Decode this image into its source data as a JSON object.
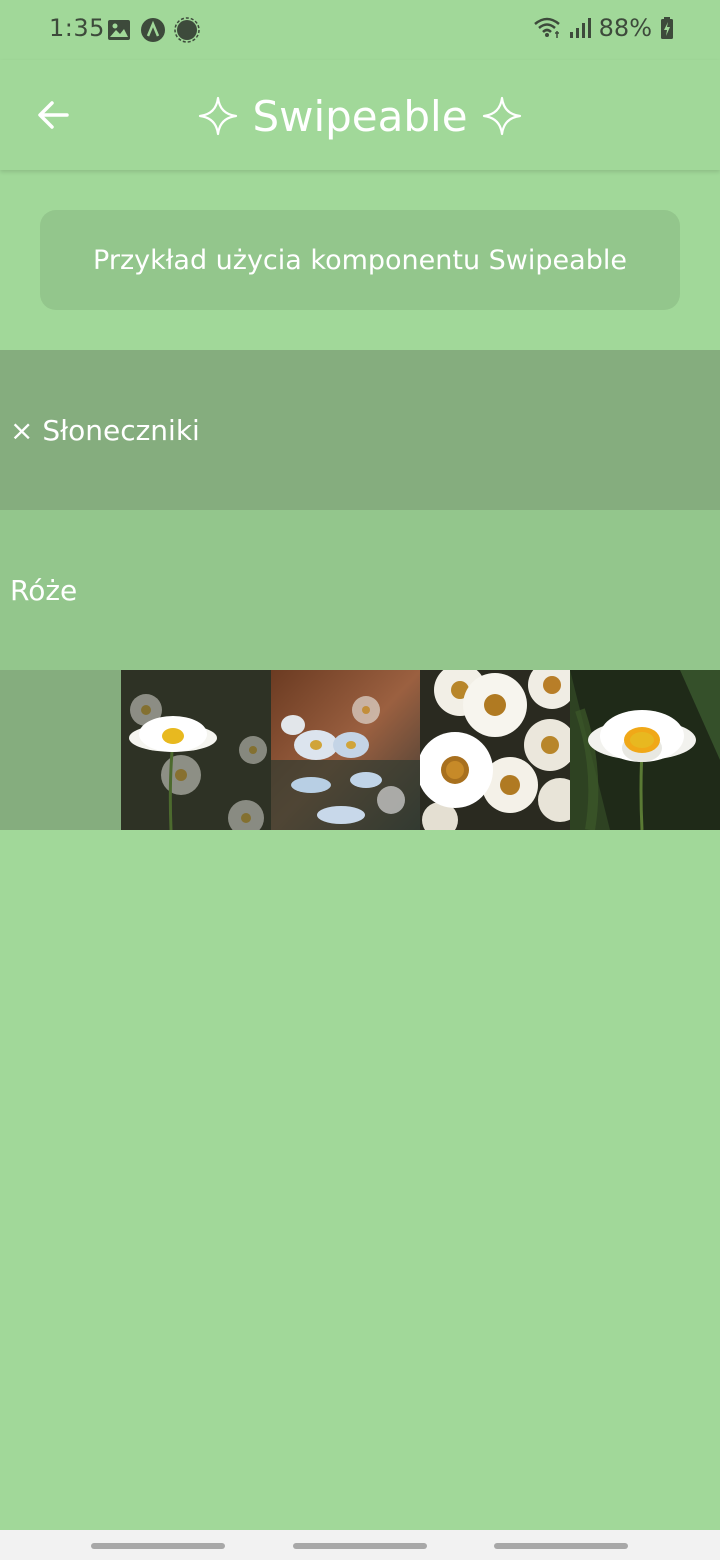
{
  "status_bar": {
    "time": "1:35",
    "battery": "88%",
    "left_icons": [
      "image-icon",
      "app-a-icon",
      "signal-messenger-icon"
    ],
    "right_icons": [
      "wifi-icon",
      "cell-signal-icon",
      "battery-charging-icon"
    ]
  },
  "app_bar": {
    "title": "Swipeable",
    "back_icon": "arrow-left-icon",
    "decor_icons": [
      "sparkle-icon",
      "sparkle-icon"
    ]
  },
  "info_box": {
    "text": "Przykład użycia komponentu Swipeable"
  },
  "rows": [
    {
      "label": "× Słoneczniki"
    },
    {
      "label": "Róże"
    }
  ],
  "gallery": {
    "photos": [
      "daisy-photo-1",
      "daisy-photo-2",
      "daisy-photo-3",
      "daisy-photo-4"
    ]
  },
  "colors": {
    "background": "#a1d899",
    "info_box": "#93c68c",
    "row_dark": "#85ad7e",
    "row_mid": "#93c68c",
    "text": "#ffffff"
  }
}
